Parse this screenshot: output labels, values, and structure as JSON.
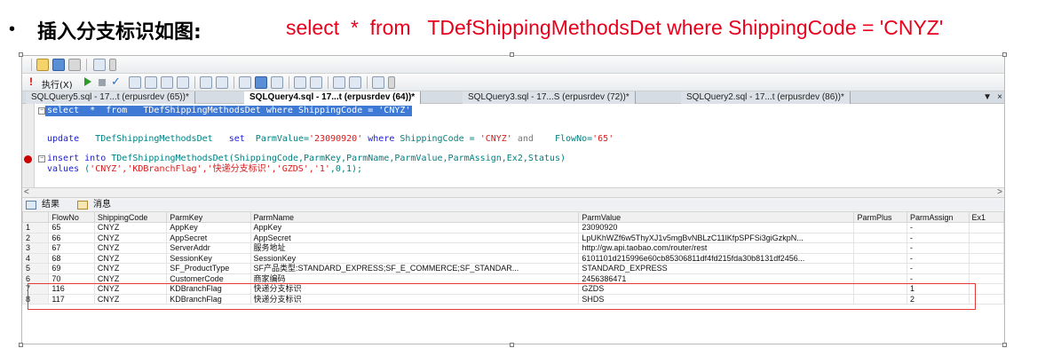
{
  "slide": {
    "bullet": "•",
    "title": "插入分支标识如图:",
    "sql": "select  *  from   TDefShippingMethodsDet where ShippingCode = 'CNYZ'"
  },
  "toolbar": {
    "exec_label": "执行(X)",
    "exec_mark": "!",
    "check": "✓"
  },
  "tabs": [
    {
      "label": "SQLQuery5.sql - 17...t (erpusrdev (65))*",
      "active": false
    },
    {
      "label": "SQLQuery4.sql - 17...t (erpusrdev (64))*",
      "active": true
    },
    {
      "label": "SQLQuery3.sql - 17...S (erpusrdev (72))*",
      "active": false
    },
    {
      "label": "SQLQuery2.sql - 17...t (erpusrdev (86))*",
      "active": false
    }
  ],
  "tab_controls": {
    "arrow": "▼",
    "close": "×"
  },
  "editor": {
    "line1": "select  *  from   TDefShippingMethodsDet where ShippingCode = 'CNYZ'",
    "line2_kw1": "update",
    "line2_tbl": "   TDefShippingMethodsDet   ",
    "line2_kw2": "set",
    "line2_rest": "  ParmValue=",
    "line2_str1": "'23090920'",
    "line2_kw3": " where",
    "line2_mid": " ShippingCode = ",
    "line2_str2": "'CNYZ'",
    "line2_kw4": " and",
    "line2_end": "    FlowNo=",
    "line2_str3": "'65'",
    "line3_kw": "insert into",
    "line3_rest": " TDefShippingMethodsDet(ShippingCode,ParmKey,ParmName,ParmValue,ParmAssign,Ex2,Status)",
    "line4_kw": "values",
    "line4_rest": " (",
    "line4_str": "'CNYZ','KDBranchFlag','快递分支标识','GZDS','1'",
    "line4_end": ",0,1);"
  },
  "scroll": {
    "left": "<",
    "right": ">"
  },
  "result_tabs": {
    "results": "结果",
    "messages": "消息"
  },
  "grid": {
    "columns": [
      "",
      "FlowNo",
      "ShippingCode",
      "ParmKey",
      "ParmName",
      "ParmValue",
      "ParmPlus",
      "ParmAssign",
      "Ex1"
    ],
    "rows": [
      [
        "1",
        "65",
        "CNYZ",
        "AppKey",
        "AppKey",
        "23090920",
        "",
        "-",
        ""
      ],
      [
        "2",
        "66",
        "CNYZ",
        "AppSecret",
        "AppSecret",
        "LpUKhWZf6w5ThyXJ1v5mgBvNBLzC11lKfpSPFSi3giGzkpN...",
        "",
        "-",
        ""
      ],
      [
        "3",
        "67",
        "CNYZ",
        "ServerAddr",
        "服务地址",
        "http://gw.api.taobao.com/router/rest",
        "",
        "-",
        ""
      ],
      [
        "4",
        "68",
        "CNYZ",
        "SessionKey",
        "SessionKey",
        "6101101d215996e60cb85306811df4fd215fda30b8131df2456...",
        "",
        "-",
        ""
      ],
      [
        "5",
        "69",
        "CNYZ",
        "SF_ProductType",
        "SF产品类型:STANDARD_EXPRESS;SF_E_COMMERCE;SF_STANDAR...",
        "STANDARD_EXPRESS",
        "",
        "-",
        ""
      ],
      [
        "6",
        "70",
        "CNYZ",
        "CustomerCode",
        "商家编码",
        "2456386471",
        "",
        "-",
        ""
      ],
      [
        "7",
        "116",
        "CNYZ",
        "KDBranchFlag",
        "快递分支标识",
        "GZDS",
        "",
        "1",
        ""
      ],
      [
        "8",
        "117",
        "CNYZ",
        "KDBranchFlag",
        "快递分支标识",
        "SHDS",
        "",
        "2",
        ""
      ]
    ]
  }
}
